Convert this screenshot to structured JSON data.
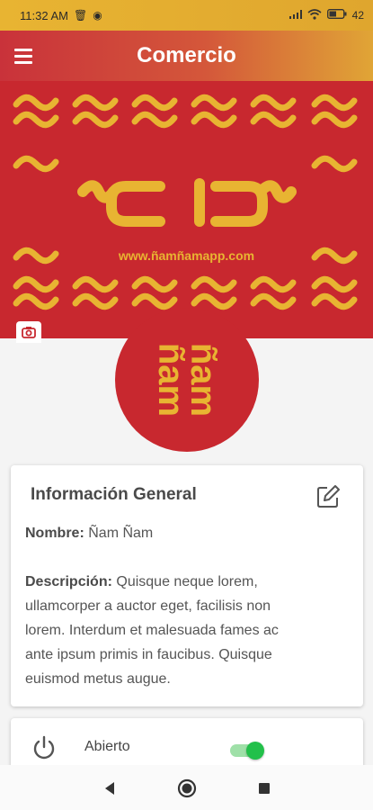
{
  "status_bar": {
    "time": "11:32 AM",
    "battery": "42"
  },
  "app_bar": {
    "title": "Comercio",
    "menu_icon": "hamburger-menu-icon"
  },
  "cover": {
    "website": "www.ñamñamapp.com",
    "camera_icon": "camera-icon"
  },
  "avatar": {
    "logo_text": "ñam ñam"
  },
  "info_card": {
    "title": "Información General",
    "edit_icon": "edit-icon",
    "name_label": "Nombre:",
    "name_value": "Ñam Ñam",
    "description_label": "Descripción:",
    "description_lines": [
      "Quisque neque lorem,",
      "ullamcorper a auctor eget, facilisis non",
      "lorem. Interdum et malesuada fames ac",
      "ante ipsum primis in faucibus. Quisque",
      "euismod metus augue."
    ]
  },
  "status_card": {
    "label": "Abierto",
    "power_icon": "power-icon",
    "toggle_on": true
  },
  "colors": {
    "brand_red": "#c8282f",
    "brand_yellow": "#e8b432",
    "toggle_green": "#22c04a"
  }
}
